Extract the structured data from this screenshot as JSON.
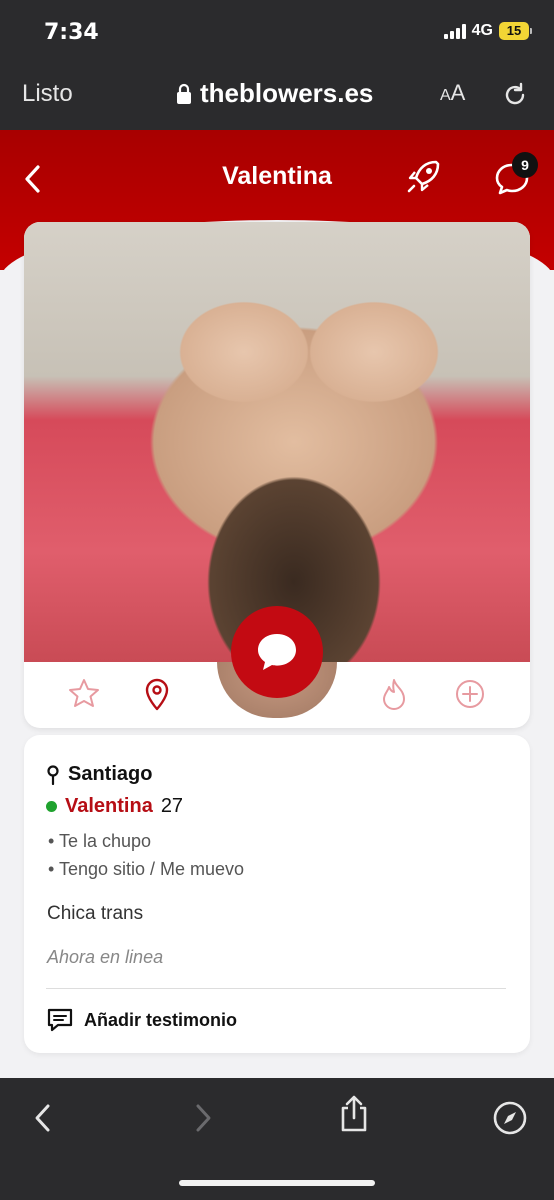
{
  "status_bar": {
    "time": "7:34",
    "network": "4G",
    "battery": "15"
  },
  "browser": {
    "done_label": "Listo",
    "url": "theblowers.es",
    "text_size_small": "A",
    "text_size_large": "A"
  },
  "header": {
    "title": "Valentina",
    "message_count": "9",
    "brand_color": "#c30a12"
  },
  "profile": {
    "location": "Santiago",
    "name": "Valentina",
    "age": "27",
    "services": [
      "• Te la chupo",
      "• Tengo sitio / Me muevo"
    ],
    "bio": "Chica trans",
    "status": "Ahora en linea",
    "testimonial_label": "Añadir testimonio"
  },
  "icons": {
    "actions": [
      "star-icon",
      "map-pin-icon",
      "flame-icon",
      "plus-circle-icon"
    ],
    "toolbar": [
      "back-arrow-icon",
      "forward-arrow-icon",
      "share-icon",
      "compass-icon"
    ]
  }
}
